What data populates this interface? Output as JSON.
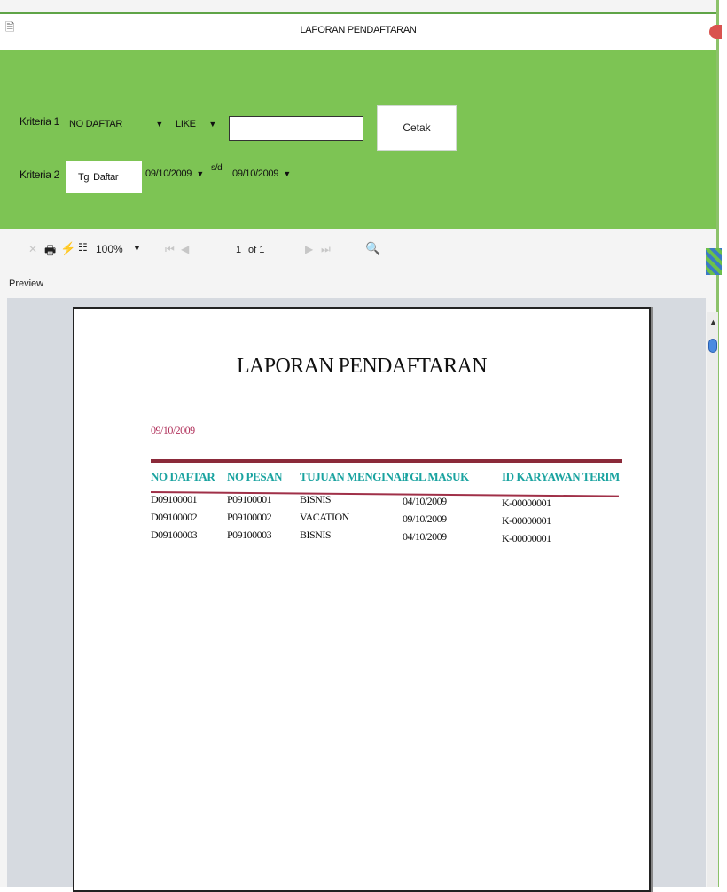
{
  "window": {
    "title": "LAPORAN PENDAFTARAN",
    "app_icon": "document-icon"
  },
  "filter": {
    "kriteria1_label": "Kriteria 1",
    "kriteria1_field": "NO DAFTAR",
    "kriteria1_operator": "LIKE",
    "kriteria1_value": "",
    "cetak_label": "Cetak",
    "kriteria2_label": "Kriteria 2",
    "kriteria2_field": "Tgl Daftar",
    "date_from": "09/10/2009",
    "range_sep": "s/d",
    "date_to": "09/10/2009"
  },
  "toolbar": {
    "zoom": "100%",
    "page_current": "1",
    "page_of": "of 1",
    "preview_label": "Preview"
  },
  "report": {
    "title": "LAPORAN PENDAFTARAN",
    "date": "09/10/2009",
    "columns": [
      "NO DAFTAR",
      "NO PESAN",
      "TUJUAN MENGINAP",
      "TGL MASUK",
      "ID KARYAWAN TERIM"
    ],
    "rows": [
      [
        "D09100001",
        "P09100001",
        "BISNIS",
        "04/10/2009",
        "K-00000001"
      ],
      [
        "D09100002",
        "P09100002",
        "VACATION",
        "09/10/2009",
        "K-00000001"
      ],
      [
        "D09100003",
        "P09100003",
        "BISNIS",
        "04/10/2009",
        "K-00000001"
      ]
    ]
  },
  "colors": {
    "panel_green": "#7dc454",
    "header_teal": "#1aa3a0",
    "accent_maroon": "#8b2a3a",
    "date_red": "#b0305a"
  }
}
